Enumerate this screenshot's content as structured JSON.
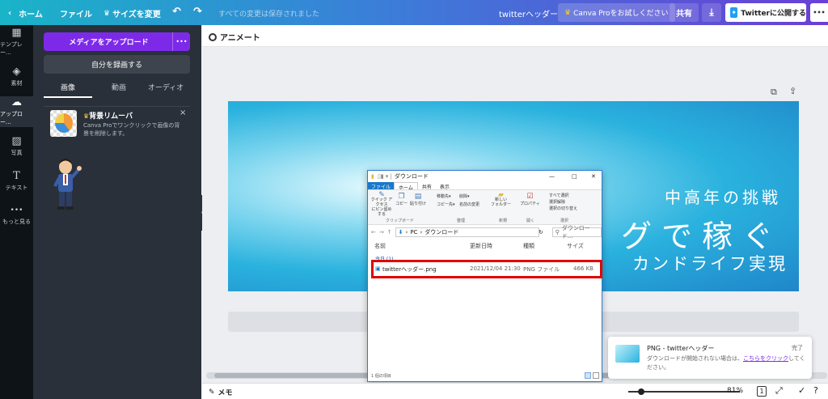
{
  "topbar": {
    "home": "ホーム",
    "file": "ファイル",
    "resize": "サイズを変更",
    "saved_status": "すべての変更は保存されました",
    "design_title": "twitterヘッダー",
    "try_pro": "Canva Proをお試しください",
    "share": "共有",
    "publish": "Twitterに公開する",
    "more": "•••"
  },
  "rail": [
    {
      "icon": "▦",
      "label": "テンプレー..."
    },
    {
      "icon": "◈",
      "label": "素材"
    },
    {
      "icon": "☁",
      "label": "アップロー..."
    },
    {
      "icon": "▨",
      "label": "写真"
    },
    {
      "icon": "T",
      "label": "テキスト"
    },
    {
      "icon": "•••",
      "label": "もっと見る"
    }
  ],
  "uploads": {
    "upload_button": "メディアをアップロード",
    "upload_more": "•••",
    "record_button": "自分を録画する",
    "tabs": [
      "画像",
      "動画",
      "オーディオ"
    ],
    "promo_title": "背景リムーバ",
    "promo_text": "Canva Proでワンクリックで画像の背景を削除します。",
    "promo_close": "×"
  },
  "canvas": {
    "animate": "アニメート",
    "line1": "中高年の挑戦",
    "line2": "グで稼ぐ",
    "line3": "カンドライフ実現"
  },
  "explorer": {
    "title": "ダウンロード",
    "menu": [
      "ファイル",
      "ホーム",
      "共有",
      "表示"
    ],
    "ribbon": {
      "pin": "クイック アクセス\nにピン留めする",
      "copy": "コピー",
      "paste": "貼り付け",
      "move": "移動先▾",
      "delete": "削除▾",
      "copy_to": "コピー先▾",
      "rename": "名前の変更",
      "new_folder": "新しい\nフォルダー",
      "properties": "プロパティ",
      "select_all": "すべて選択",
      "select_none": "選択解除",
      "invert": "選択の切り替え",
      "groups": [
        "クリップボード",
        "整理",
        "新規",
        "開く",
        "選択"
      ]
    },
    "path": [
      "PC",
      "ダウンロード"
    ],
    "search_placeholder": "ダウンロード...",
    "columns": [
      "名前",
      "更新日時",
      "種類",
      "サイズ"
    ],
    "group_label": "今日 (1)",
    "file": {
      "name": "twitterヘッダー.png",
      "date": "2021/12/04 21:30",
      "type": "PNG ファイル",
      "size": "466 KB"
    },
    "status": "1 個の項目"
  },
  "toast": {
    "title": "PNG - twitterヘッダー",
    "done": "完了",
    "message_a": "ダウンロードが開始されない場合は、",
    "link": "こちらをクリック",
    "message_b": "してください。"
  },
  "bottom": {
    "notes": "メモ",
    "zoom": "81%",
    "page": "1"
  },
  "colors": {
    "purple": "#7d2ae8",
    "highlight": "#e00000"
  }
}
